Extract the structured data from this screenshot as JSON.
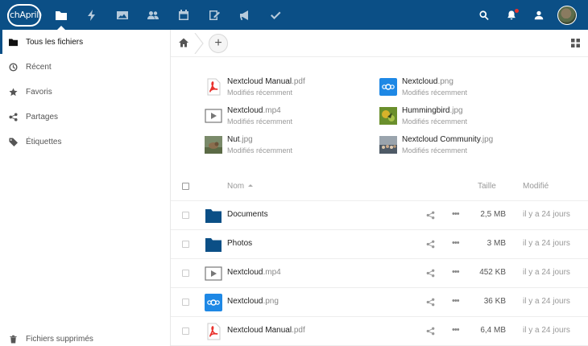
{
  "header": {
    "logo_text": "(chApril)",
    "apps": [
      {
        "name": "files-icon",
        "active": true
      },
      {
        "name": "activity-icon",
        "active": false
      },
      {
        "name": "gallery-icon",
        "active": false
      },
      {
        "name": "contacts-icon",
        "active": false
      },
      {
        "name": "calendar-icon",
        "active": false
      },
      {
        "name": "notes-icon",
        "active": false
      },
      {
        "name": "announcement-icon",
        "active": false
      },
      {
        "name": "tasks-icon",
        "active": false
      }
    ],
    "accent": "#0b4f86"
  },
  "sidebar": {
    "items": [
      {
        "label": "Tous les fichiers",
        "icon": "folder-icon",
        "active": true
      },
      {
        "label": "Récent",
        "icon": "clock-icon"
      },
      {
        "label": "Favoris",
        "icon": "star-icon"
      },
      {
        "label": "Partages",
        "icon": "share-icon"
      },
      {
        "label": "Étiquettes",
        "icon": "tag-icon"
      }
    ],
    "trash_label": "Fichiers supprimés"
  },
  "controls": {
    "add_label": "+"
  },
  "recent": [
    {
      "base": "Nextcloud Manual",
      "ext": ".pdf",
      "sub": "Modifiés récemment",
      "icon": "pdf-icon"
    },
    {
      "base": "Nextcloud",
      "ext": ".png",
      "sub": "Modifiés récemment",
      "icon": "nextcloud-logo-icon"
    },
    {
      "base": "Nextcloud",
      "ext": ".mp4",
      "sub": "Modifiés récemment",
      "icon": "video-icon"
    },
    {
      "base": "Hummingbird",
      "ext": ".jpg",
      "sub": "Modifiés récemment",
      "icon": "image-thumbnail-icon"
    },
    {
      "base": "Nut",
      "ext": ".jpg",
      "sub": "Modifiés récemment",
      "icon": "image-thumbnail-icon"
    },
    {
      "base": "Nextcloud Community",
      "ext": ".jpg",
      "sub": "Modifiés récemment",
      "icon": "image-thumbnail-icon"
    }
  ],
  "table": {
    "col_name": "Nom",
    "col_size": "Taille",
    "col_modified": "Modifié",
    "rows": [
      {
        "base": "Documents",
        "ext": "",
        "size": "2,5 MB",
        "modified": "il y a 24 jours",
        "icon": "folder-icon"
      },
      {
        "base": "Photos",
        "ext": "",
        "size": "3 MB",
        "modified": "il y a 24 jours",
        "icon": "folder-icon"
      },
      {
        "base": "Nextcloud",
        "ext": ".mp4",
        "size": "452 KB",
        "modified": "il y a 24 jours",
        "icon": "video-icon"
      },
      {
        "base": "Nextcloud",
        "ext": ".png",
        "size": "36 KB",
        "modified": "il y a 24 jours",
        "icon": "nextcloud-logo-icon"
      },
      {
        "base": "Nextcloud Manual",
        "ext": ".pdf",
        "size": "6,4 MB",
        "modified": "il y a 24 jours",
        "icon": "pdf-icon"
      }
    ],
    "more_label": "•••"
  }
}
